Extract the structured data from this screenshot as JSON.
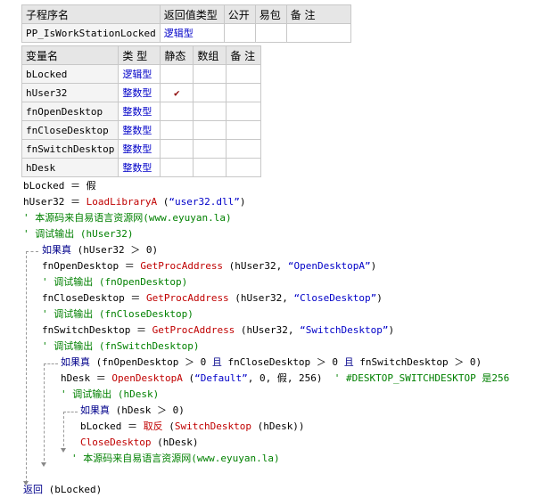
{
  "sub_table": {
    "headers": [
      "子程序名",
      "返回值类型",
      "公开",
      "易包",
      "备 注"
    ],
    "row": {
      "name": "PP_IsWorkStationLocked",
      "return_type": "逻辑型",
      "public": "",
      "epack": "",
      "note": ""
    }
  },
  "var_table": {
    "headers": [
      "变量名",
      "类 型",
      "静态",
      "数组",
      "备 注"
    ],
    "rows": [
      {
        "name": "bLocked",
        "type": "逻辑型",
        "static": "",
        "array": "",
        "note": ""
      },
      {
        "name": "hUser32",
        "type": "整数型",
        "static": "✔",
        "array": "",
        "note": ""
      },
      {
        "name": "fnOpenDesktop",
        "type": "整数型",
        "static": "",
        "array": "",
        "note": ""
      },
      {
        "name": "fnCloseDesktop",
        "type": "整数型",
        "static": "",
        "array": "",
        "note": ""
      },
      {
        "name": "fnSwitchDesktop",
        "type": "整数型",
        "static": "",
        "array": "",
        "note": ""
      },
      {
        "name": "hDesk",
        "type": "整数型",
        "static": "",
        "array": "",
        "note": ""
      }
    ]
  },
  "code": {
    "l1": "bLocked ＝ 假",
    "l2a": "hUser32 ＝ ",
    "l2b": "LoadLibraryA",
    "l2c": " (",
    "l2d": "“user32.dll”",
    "l2e": ")",
    "l3": "' 本源码来自易语言资源网(www.eyuyan.la)",
    "l4": "' 调试输出 (hUser32)",
    "l5a": "如果真",
    "l5b": " (hUser32 ＞ 0)",
    "l6a": "fnOpenDesktop ＝ ",
    "l6b": "GetProcAddress",
    "l6c": " (hUser32, ",
    "l6d": "“OpenDesktopA”",
    "l6e": ")",
    "l7": "' 调试输出 (fnOpenDesktop)",
    "l8a": "fnCloseDesktop ＝ ",
    "l8b": "GetProcAddress",
    "l8c": " (hUser32, ",
    "l8d": "“CloseDesktop”",
    "l8e": ")",
    "l9": "' 调试输出 (fnCloseDesktop)",
    "l10a": "fnSwitchDesktop ＝ ",
    "l10b": "GetProcAddress",
    "l10c": " (hUser32, ",
    "l10d": "“SwitchDesktop”",
    "l10e": ")",
    "l11": "' 调试输出 (fnSwitchDesktop)",
    "l12a": "如果真",
    "l12b": " (fnOpenDesktop ＞ 0 ",
    "l12c": "且",
    "l12d": " fnCloseDesktop ＞ 0 ",
    "l12e": "且",
    "l12f": " fnSwitchDesktop ＞ 0)",
    "l13a": "hDesk ＝ ",
    "l13b": "OpenDesktopA",
    "l13c": " (",
    "l13d": "“Default”",
    "l13e": ", 0, 假, 256)  ",
    "l13f": "' #DESKTOP_SWITCHDESKTOP 是256",
    "l14": "' 调试输出 (hDesk)",
    "l15a": "如果真",
    "l15b": " (hDesk ＞ 0)",
    "l16a": "bLocked ＝ ",
    "l16b": "取反",
    "l16c": " (",
    "l16d": "SwitchDesktop",
    "l16e": " (hDesk))",
    "l17a": "CloseDesktop",
    "l17b": " (hDesk)",
    "l18": "' 本源码来自易语言资源网(www.eyuyan.la)",
    "l19a": "返回",
    "l19b": " (bLocked)"
  }
}
